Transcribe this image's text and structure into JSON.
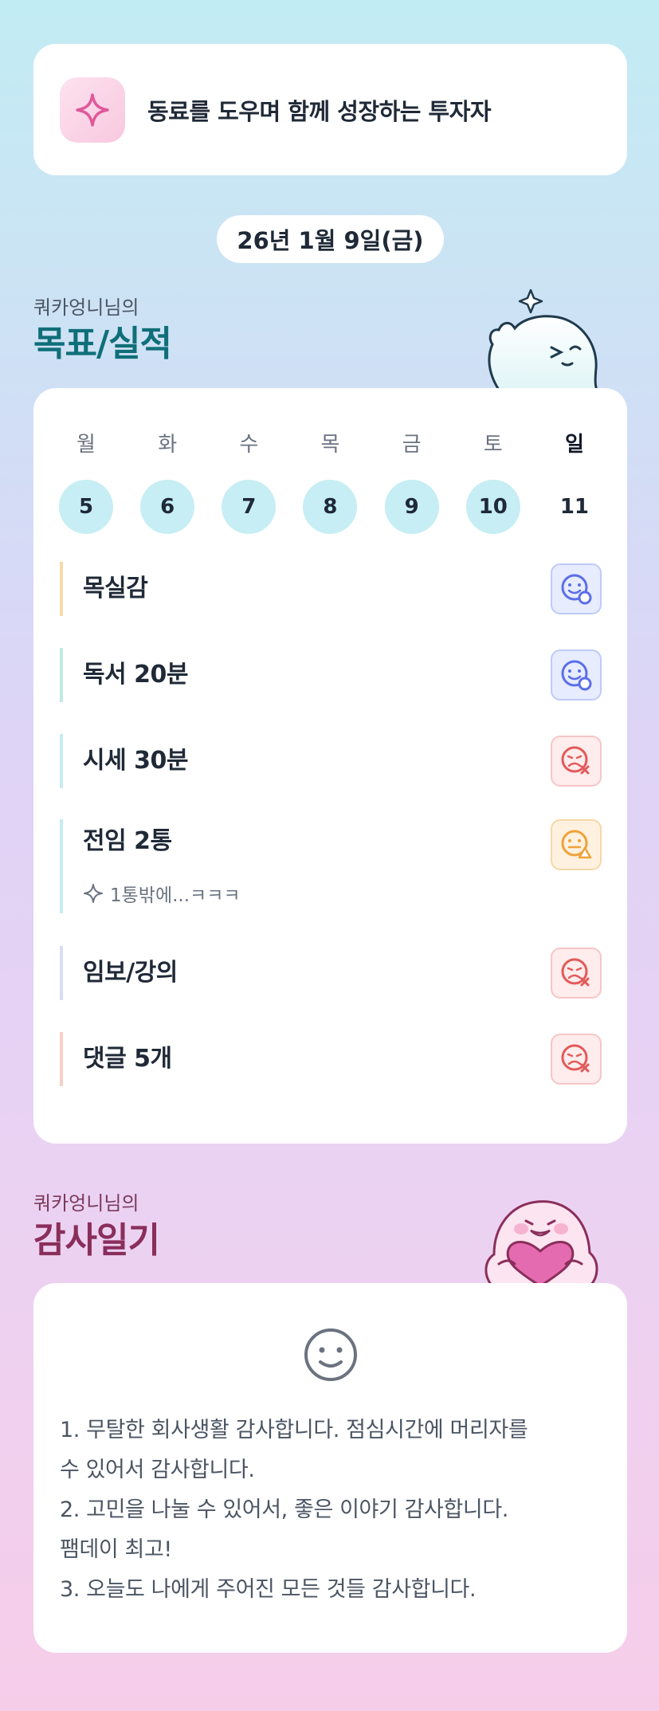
{
  "banner": {
    "icon": "sparkle-icon",
    "text": "동료를 도우며 함께 성장하는 투자자"
  },
  "date": "26년 1월 9일(금)",
  "goals": {
    "subtitle": "쿼카엉니님의",
    "title": "목표/실적",
    "weekdays": [
      "월",
      "화",
      "수",
      "목",
      "금",
      "토",
      "일"
    ],
    "days": [
      "5",
      "6",
      "7",
      "8",
      "9",
      "10",
      "11"
    ],
    "items": [
      {
        "name": "목실감",
        "status": "good",
        "bar_color": "#f8d9a8"
      },
      {
        "name": "독서 20분",
        "status": "good",
        "bar_color": "#bfeadf"
      },
      {
        "name": "시세 30분",
        "status": "bad",
        "bar_color": "#c4ecf2"
      },
      {
        "name": "전임 2통",
        "status": "warn",
        "bar_color": "#c4ecf2",
        "note": "1통밖에...ㅋㅋㅋ"
      },
      {
        "name": "임보/강의",
        "status": "bad",
        "bar_color": "#d7ddf5"
      },
      {
        "name": "댓글 5개",
        "status": "bad",
        "bar_color": "#f8d0c4"
      }
    ]
  },
  "thanks": {
    "subtitle": "쿼카엉니님의",
    "title": "감사일기",
    "icon": "smile-icon",
    "lines": [
      "1. 무탈한 회사생활 감사합니다. 점심시간에 머리자를",
      "수 있어서 감사합니다.",
      "2. 고민을 나눌 수 있어서, 좋은 이야기 감사합니다.",
      "팸데이 최고!",
      "3. 오늘도 나에게 주어진 모든 것들 감사합니다."
    ]
  },
  "colors": {
    "good": "#5b6ee8",
    "bad": "#e25a5a",
    "warn": "#f0a23a",
    "accent_teal": "#0f6f78",
    "accent_pink": "#8a2e5b"
  }
}
